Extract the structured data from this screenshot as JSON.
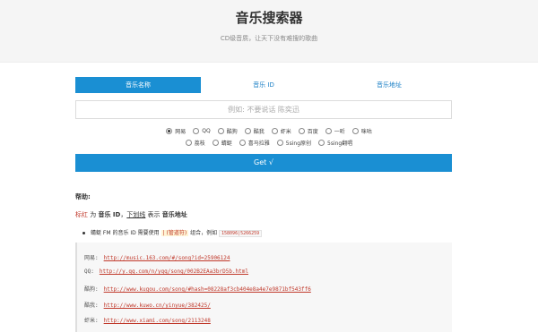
{
  "header": {
    "title": "音乐搜索器",
    "subtitle": "CD级音质，让天下没有难搜的歌曲"
  },
  "tabs": [
    {
      "label": "音乐名称",
      "active": true
    },
    {
      "label": "音乐 ID",
      "active": false
    },
    {
      "label": "音乐地址",
      "active": false
    }
  ],
  "search": {
    "placeholder": "例如: 不要说话 陈奕迅",
    "value": ""
  },
  "sources_row1": [
    {
      "label": "网易",
      "checked": true
    },
    {
      "label": "QQ",
      "checked": false
    },
    {
      "label": "酷狗",
      "checked": false
    },
    {
      "label": "酷我",
      "checked": false
    },
    {
      "label": "虾米",
      "checked": false
    },
    {
      "label": "百度",
      "checked": false
    },
    {
      "label": "一听",
      "checked": false
    },
    {
      "label": "咪咕",
      "checked": false
    }
  ],
  "sources_row2": [
    {
      "label": "荔枝",
      "checked": false
    },
    {
      "label": "蜻蜓",
      "checked": false
    },
    {
      "label": "喜马拉雅",
      "checked": false
    },
    {
      "label": "5sing原创",
      "checked": false
    },
    {
      "label": "5sing翻唱",
      "checked": false
    }
  ],
  "get_button": {
    "label": "Get √"
  },
  "help": {
    "title": "帮助:",
    "desc_red": "标红",
    "desc_1": " 为 ",
    "desc_id": "音乐 ID",
    "desc_2": "，",
    "desc_underline": "下划线",
    "desc_3": " 表示 ",
    "desc_addr": "音乐地址",
    "bullet_1": "蜻蜓 FM 的音乐 ID 需要使用 ",
    "bullet_hl": "| (管道符)",
    "bullet_2": " 组合，例如 ",
    "bullet_code": "158096|5266259"
  },
  "examples": [
    {
      "label": "网易:",
      "url": "http://music.163.com/#/song?id=25906124"
    },
    {
      "label": "QQ:",
      "url": "http://y.qq.com/n/yqq/song/002B2EAa3brD5b.html"
    },
    {
      "label": "酷狗:",
      "url": "http://www.kugou.com/song/#hash=08228af3cb404e8a4e7e9871bf543ff6"
    },
    {
      "label": "酷我:",
      "url": "http://www.kuwo.cn/yinyue/382425/"
    },
    {
      "label": "虾米:",
      "url": "http://www.xiami.com/song/2113248"
    }
  ]
}
